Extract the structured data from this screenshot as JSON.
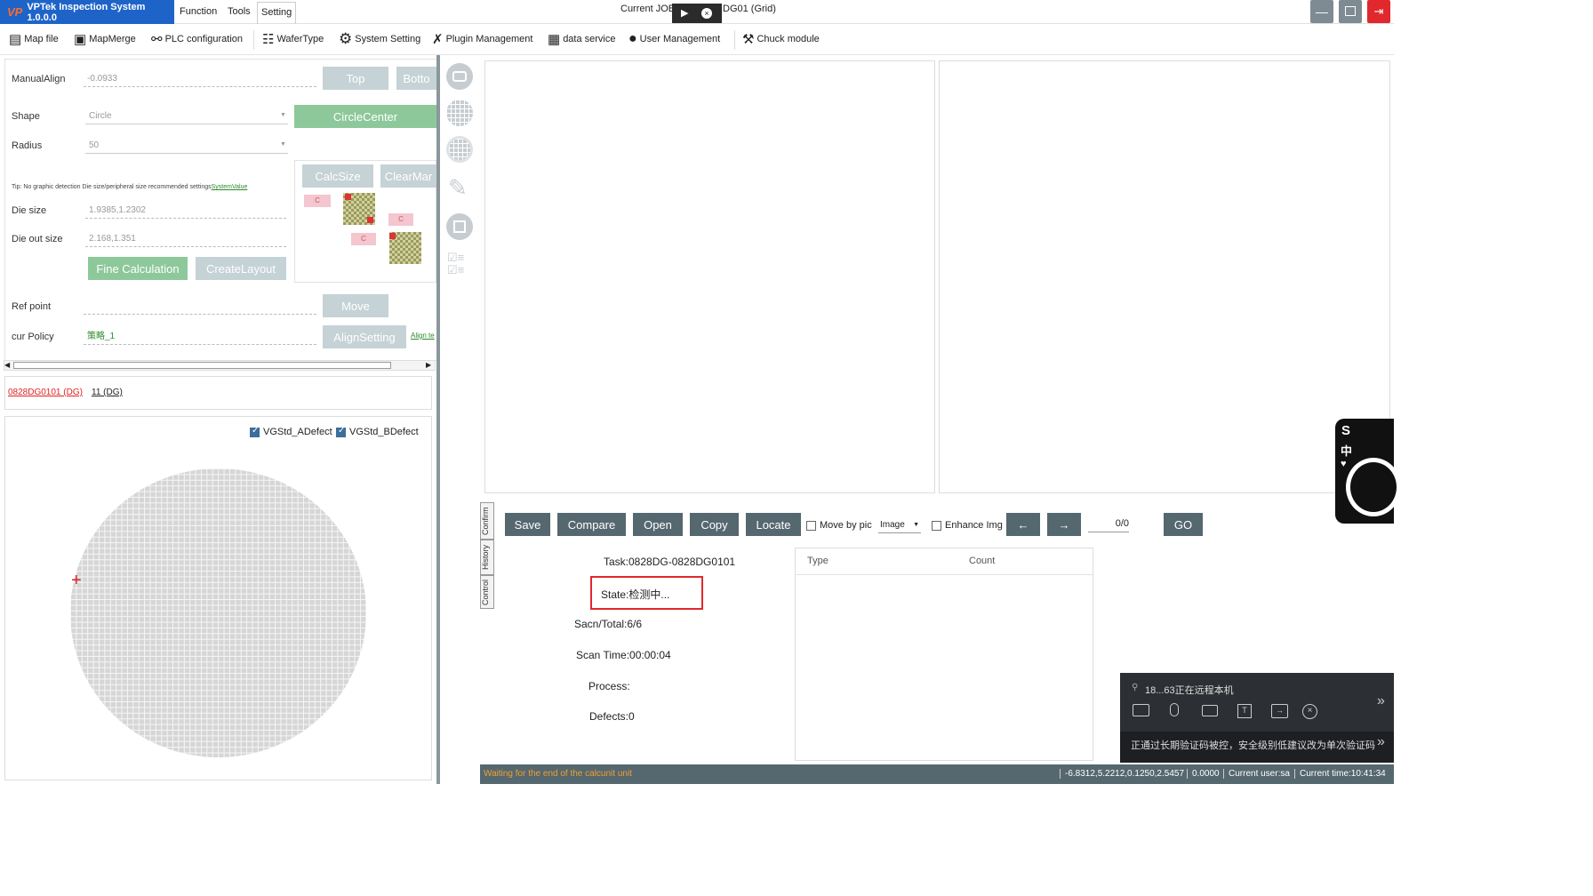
{
  "app": {
    "logo": "VP",
    "title": "VPTek Inspection System 1.0.0.0"
  },
  "menu": [
    "Function",
    "Tools",
    "Setting"
  ],
  "current_job": {
    "prefix": "Current JOB",
    "suffix": "DG01 (Grid)"
  },
  "toolbar": [
    "Map file",
    "MapMerge",
    "PLC configuration",
    "WaferType",
    "System Setting",
    "Plugin Management",
    "data service",
    "User Management",
    "Chuck module"
  ],
  "align": {
    "manual_align_label": "ManualAlign",
    "manual_align_value": "-0.0933",
    "top_btn": "Top",
    "bottom_btn": "Botto",
    "shape_label": "Shape",
    "shape_value": "Circle",
    "circle_center_btn": "CircleCenter",
    "radius_label": "Radius",
    "radius_value": "50",
    "calc_size_btn": "CalcSize",
    "clear_map_btn": "ClearMar",
    "tip": "Tip: No graphic detection Die size/peripheral size recommended settings",
    "tip_link": "SystemValue",
    "die_size_label": "Die size",
    "die_size_value": "1.9385,1.2302",
    "die_out_label": "Die out size",
    "die_out_value": "2.168,1.351",
    "fine_calc_btn": "Fine Calculation",
    "create_layout_btn": "CreateLayout",
    "ref_point_label": "Ref point",
    "move_btn": "Move",
    "cur_policy_label": "cur Policy",
    "cur_policy_value": "策略_1",
    "align_setting_btn": "AlignSetting",
    "align_link": "Align te",
    "diagram_labels": [
      "C",
      "C",
      "C"
    ]
  },
  "wafer_links": [
    "0828DG0101 (DG)",
    "11 (DG)"
  ],
  "defect_filters": [
    {
      "label": "VGStd_ADefect",
      "checked": true
    },
    {
      "label": "VGStd_BDefect",
      "checked": true
    }
  ],
  "vertical_tabs": [
    "Confirm",
    "History",
    "Control"
  ],
  "controls": {
    "save": "Save",
    "compare": "Compare",
    "open": "Open",
    "copy": "Copy",
    "locate": "Locate",
    "move_by_pic": "Move by pic",
    "image_select": "Image",
    "enhance_img": "Enhance Img",
    "prev": "←",
    "next": "→",
    "page": "0/0",
    "go": "GO"
  },
  "status_info": {
    "task": "Task:0828DG-0828DG0101",
    "state": "State:检测中...",
    "scan_total": "Sacn/Total:6/6",
    "scan_time": "Scan Time:00:00:04",
    "process": "Process:",
    "defects": "Defects:0"
  },
  "defect_table": {
    "columns": [
      "Type",
      "Count"
    ],
    "rows": []
  },
  "remote_panel": {
    "title": "18...63正在远程本机",
    "warning": "正通过长期验证码被控，安全级别低建议改为单次验证码"
  },
  "ime": {
    "chars": [
      "S",
      "中"
    ]
  },
  "statusbar": {
    "message": "Waiting for the end of the calcunit unit",
    "coords": "-6.8312,5.2212,0.1250,2.5457",
    "value": "0.0000",
    "user": "Current user:sa",
    "time": "Current time:10:41:34"
  },
  "colors": {
    "accent": "#1e64c8",
    "statusbar": "#55676f",
    "highlight_box": "#e0282d",
    "warning_text": "#f0a030"
  }
}
